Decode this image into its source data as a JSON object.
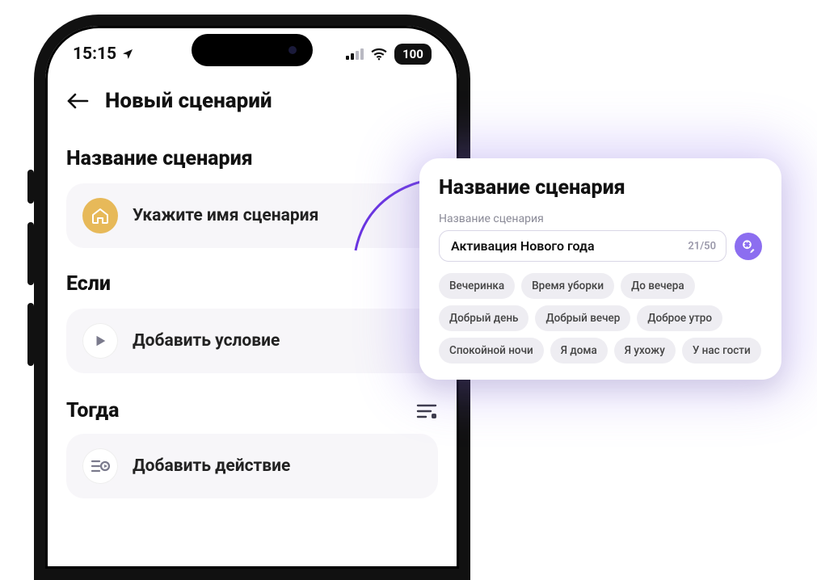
{
  "status": {
    "time": "15:15",
    "battery": "100"
  },
  "nav": {
    "title": "Новый сценарий"
  },
  "sections": {
    "name": {
      "heading": "Название сценария",
      "row_label": "Укажите имя сценария"
    },
    "if": {
      "heading": "Если",
      "row_label": "Добавить условие"
    },
    "then": {
      "heading": "Тогда",
      "row_label": "Добавить действие"
    }
  },
  "popover": {
    "title": "Название сценария",
    "field_label": "Название сценария",
    "value": "Активация Нового года",
    "counter": "21/50",
    "suggestions": [
      "Вечеринка",
      "Время уборки",
      "До вечера",
      "Добрый день",
      "Добрый вечер",
      "Доброе утро",
      "Спокойной ночи",
      "Я дома",
      "Я ухожу",
      "У нас гости"
    ]
  }
}
